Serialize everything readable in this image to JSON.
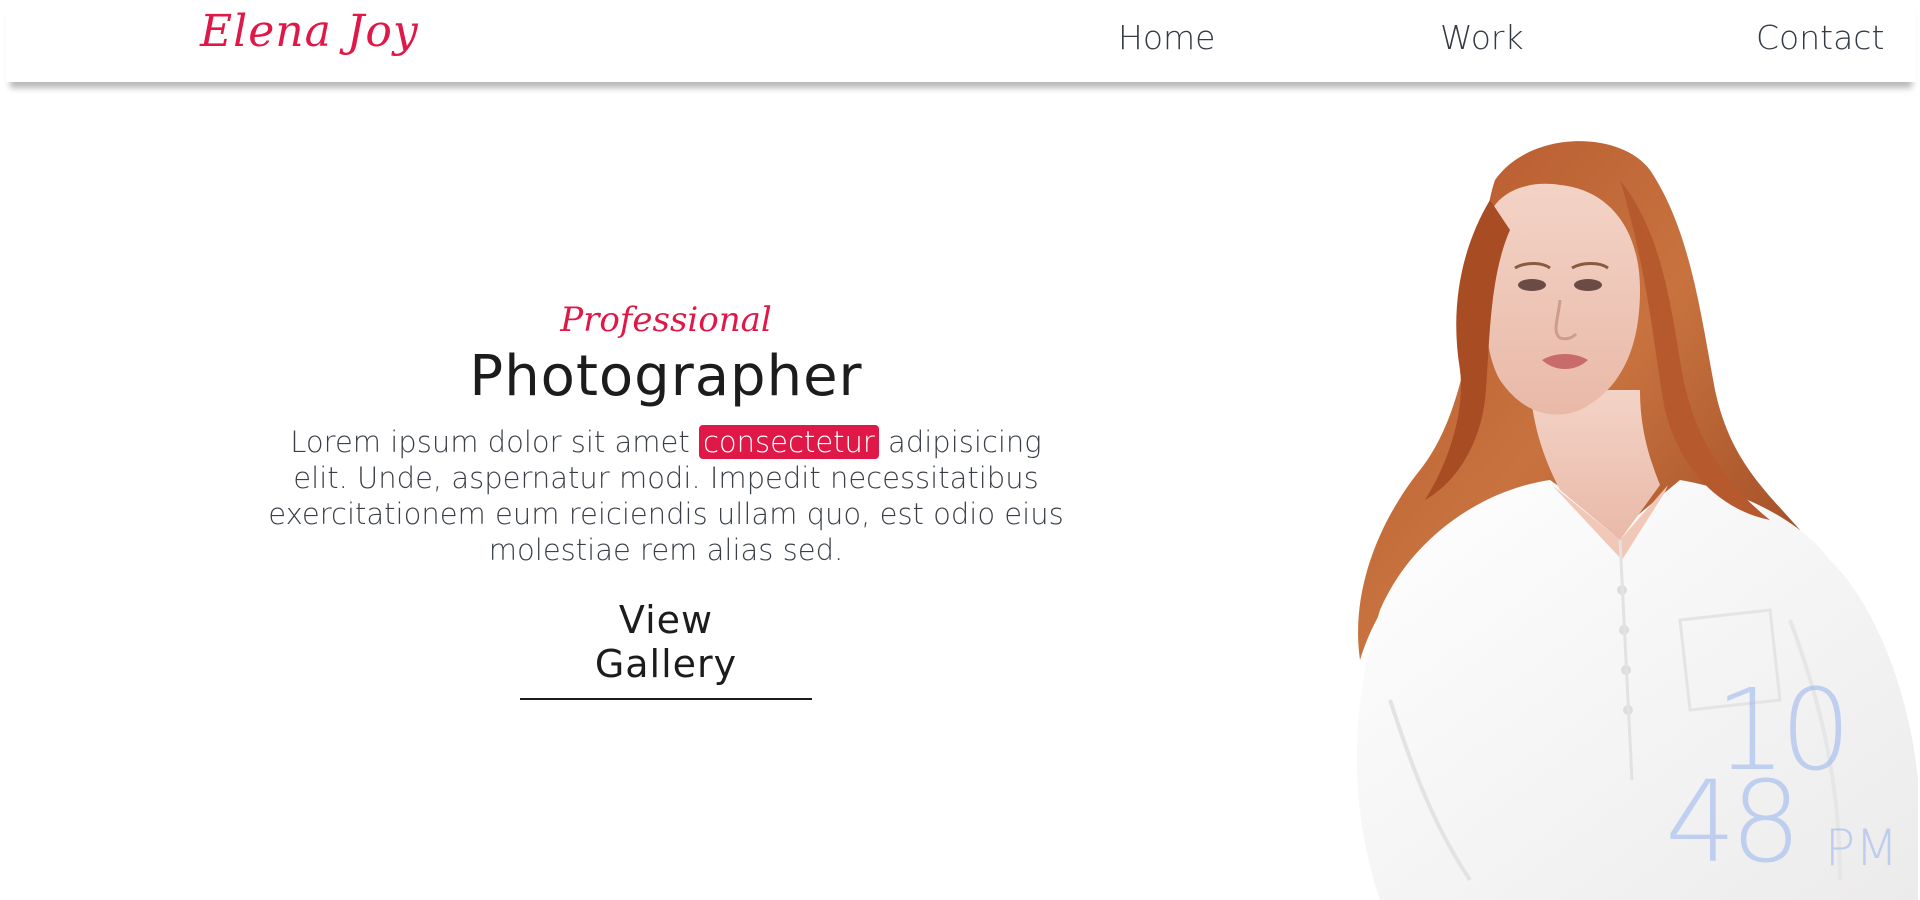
{
  "header": {
    "logo": "Elena Joy",
    "nav": {
      "home": "Home",
      "work": "Work",
      "contact": "Contact"
    }
  },
  "hero": {
    "kicker": "Professional",
    "title": "Photographer",
    "description": {
      "before": "Lorem ipsum dolor sit amet ",
      "highlight": "consectetur",
      "after": " adipisicing elit. Unde, aspernatur modi. Impedit necessitatibus exercitationem eum reiciendis ullam quo, est odio eius molestiae rem alias sed."
    },
    "button": "View Gallery"
  },
  "clock": {
    "hours": "10",
    "minutes": "48",
    "ampm": "PM"
  },
  "colors": {
    "accent": "#e01848",
    "text": "#1c1c1c",
    "nav_text": "#333a44"
  }
}
